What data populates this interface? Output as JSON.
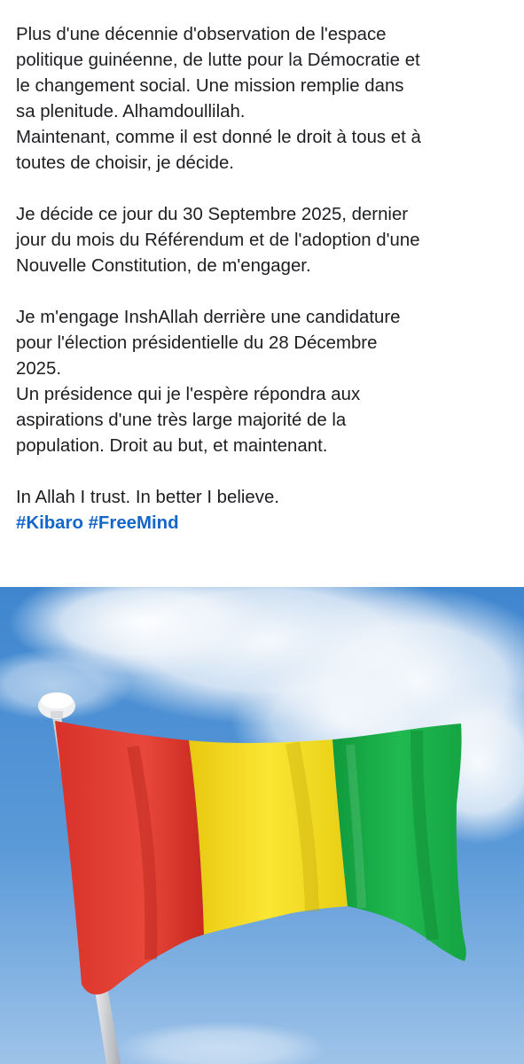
{
  "post": {
    "paragraphs": [
      {
        "lines": [
          "Plus d'une décennie d'observation de l'espace",
          "politique guinéenne, de lutte pour la Démocratie et",
          "le changement social. Une mission remplie dans",
          "sa plenitude. Alhamdoullilah.",
          "Maintenant, comme il est donné le droit à tous et à",
          "toutes de choisir, je décide."
        ]
      },
      {
        "lines": [
          "Je décide ce jour du 30 Septembre 2025, dernier",
          "jour du mois du Référendum et de l'adoption d'une",
          "Nouvelle Constitution, de m'engager."
        ]
      },
      {
        "lines": [
          "Je m'engage InshAllah derrière une candidature",
          "pour l'élection présidentielle du 28 Décembre",
          "2025.",
          "Un présidence qui je l'espère répondra aux",
          "aspirations d'une très large majorité de la",
          "population. Droit au but, et maintenant."
        ]
      }
    ],
    "closing_line": "In Allah I trust. In better I believe.",
    "hashtags": [
      "#Kibaro",
      "#FreeMind"
    ],
    "hashtag_color": "#1467c8",
    "text_color": "#1c1e21"
  },
  "photo": {
    "subject": "flag-of-guinea",
    "sky_colors": [
      "#3f86cf",
      "#5b9ad8",
      "#9ec3e9"
    ],
    "flag_colors": {
      "red": "#e53a30",
      "yellow": "#f7dc1d",
      "green": "#1bb04a"
    }
  }
}
